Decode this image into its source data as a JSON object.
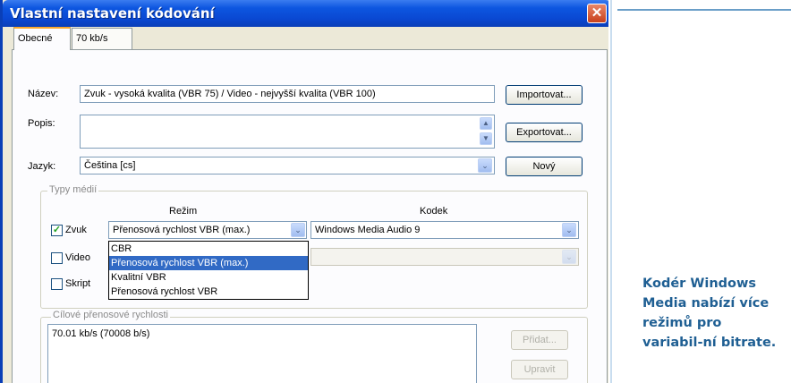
{
  "window": {
    "title": "Vlastní nastavení kódování",
    "close_glyph": "✕"
  },
  "tabs": [
    {
      "label": "Obecné"
    },
    {
      "label": "70 kb/s"
    }
  ],
  "form": {
    "name_label": "Název:",
    "name_value": "Zvuk - vysoká kvalita (VBR 75) / Video - nejvyšší kvalita (VBR 100)",
    "import_button": "Importovat...",
    "desc_label": "Popis:",
    "desc_value": "",
    "export_button": "Exportovat...",
    "lang_label": "Jazyk:",
    "lang_value": "Čeština [cs]",
    "new_button": "Nový"
  },
  "media_types": {
    "group_title": "Typy médií",
    "mode_header": "Režim",
    "codec_header": "Kodek",
    "rows": [
      {
        "label": "Zvuk",
        "checked": true,
        "mode": "Přenosová rychlost VBR (max.)",
        "codec": "Windows Media Audio 9"
      },
      {
        "label": "Video",
        "checked": false
      },
      {
        "label": "Skript",
        "checked": false
      }
    ],
    "mode_options": [
      "CBR",
      "Přenosová rychlost VBR (max.)",
      "Kvalitní VBR",
      "Přenosová rychlost VBR"
    ],
    "selected_option_index": 1
  },
  "bitrates": {
    "group_title": "Cílové přenosové rychlosti",
    "items": [
      "70.01 kb/s (70008 b/s)"
    ],
    "add_button": "Přidat...",
    "edit_button": "Upravit"
  },
  "caption": "Kodér Windows Media nabízí více režimů pro variabil-ní bitrate.",
  "icons": {
    "combo_arrow": "⌄",
    "spin_up": "▲",
    "spin_down": "▼",
    "check": "✓"
  },
  "colors": {
    "titlebar": "#0a48d2",
    "selection": "#316ac5",
    "caption_text": "#1f5f93"
  }
}
